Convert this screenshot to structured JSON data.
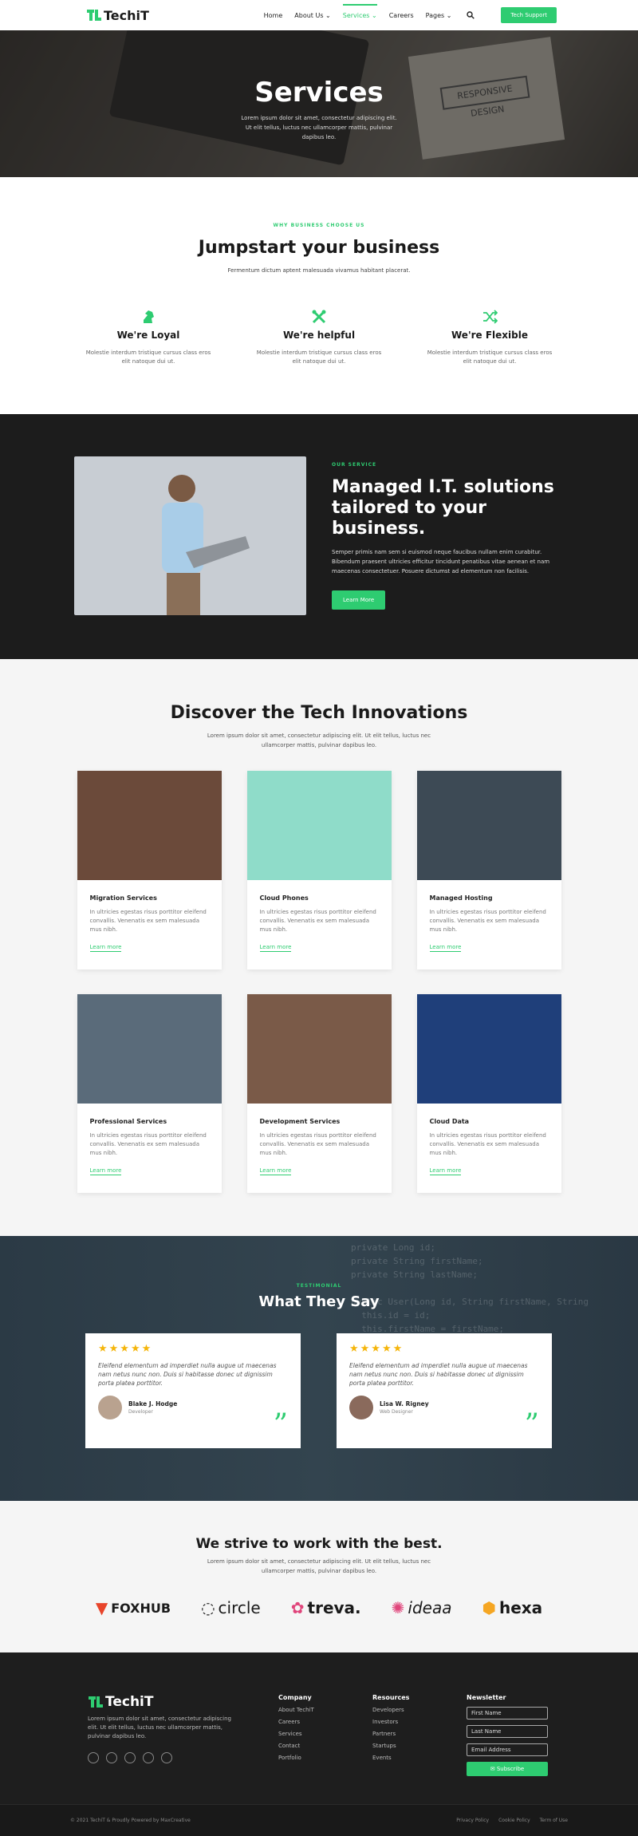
{
  "header": {
    "logo": "TechiT",
    "nav": [
      "Home",
      "About Us",
      "Services",
      "Careers",
      "Pages"
    ],
    "cta": "Tech Support"
  },
  "hero": {
    "title": "Services",
    "text": "Lorem ipsum dolor sit amet, consectetur adipiscing elit. Ut elit tellus, luctus nec ullamcorper mattis, pulvinar dapibus leo.",
    "notebook_text": "RESPONSIVE DESIGN"
  },
  "why": {
    "eyebrow": "WHY BUSINESS CHOOSE US",
    "title": "Jumpstart your business",
    "subtitle": "Fermentum dictum aptent malesuada vivamus habitant placerat.",
    "features": [
      {
        "icon": "horse-icon",
        "title": "We're Loyal",
        "text": "Molestie interdum tristique cursus class eros elit natoque dui ut."
      },
      {
        "icon": "tools-icon",
        "title": "We're helpful",
        "text": "Molestie interdum tristique cursus class eros elit natoque dui ut."
      },
      {
        "icon": "shuffle-icon",
        "title": "We're Flexible",
        "text": "Molestie interdum tristique cursus class eros elit natoque dui ut."
      }
    ]
  },
  "service": {
    "eyebrow": "OUR SERVICE",
    "title": "Managed I.T. solutions tailored to your business.",
    "text": "Semper primis nam sem si euismod neque faucibus nullam enim curabitur. Bibendum praesent ultricies efficitur tincidunt penatibus vitae aenean et nam maecenas consectetuer. Posuere dictumst ad elementum non facilisis.",
    "button": "Learn More"
  },
  "innovations": {
    "title": "Discover the Tech Innovations",
    "subtitle": "Lorem ipsum dolor sit amet, consectetur adipiscing elit. Ut elit tellus, luctus nec ullamcorper mattis, pulvinar dapibus leo.",
    "cards": [
      {
        "title": "Migration Services",
        "text": "In ultricies egestas risus porttitor eleifend convallis. Venenatis ex sem malesuada mus nibh.",
        "link": "Learn more",
        "bg": "#6b4a3a"
      },
      {
        "title": "Cloud Phones",
        "text": "In ultricies egestas risus porttitor eleifend convallis. Venenatis ex sem malesuada mus nibh.",
        "link": "Learn more",
        "bg": "#8fdcc9"
      },
      {
        "title": "Managed Hosting",
        "text": "In ultricies egestas risus porttitor eleifend convallis. Venenatis ex sem malesuada mus nibh.",
        "link": "Learn more",
        "bg": "#3d4a55"
      },
      {
        "title": "Professional Services",
        "text": "In ultricies egestas risus porttitor eleifend convallis. Venenatis ex sem malesuada mus nibh.",
        "link": "Learn more",
        "bg": "#5a6b7a"
      },
      {
        "title": "Development Services",
        "text": "In ultricies egestas risus porttitor eleifend convallis. Venenatis ex sem malesuada mus nibh.",
        "link": "Learn more",
        "bg": "#7a5a48"
      },
      {
        "title": "Cloud Data",
        "text": "In ultricies egestas risus porttitor eleifend convallis. Venenatis ex sem malesuada mus nibh.",
        "link": "Learn more",
        "bg": "#1f3f7a"
      }
    ]
  },
  "testimonials": {
    "eyebrow": "TESTIMONIAL",
    "title": "What They Say",
    "code_bg": "private Long id;\nprivate String firstName;\nprivate String lastName;\n\npublic User(Long id, String firstName, String\n  this.id = id;\n  this.firstName = firstName;\n  this.lastName = lastName;",
    "items": [
      {
        "stars": "★★★★★",
        "quote": "Eleifend elementum ad imperdiet nulla augue ut maecenas nam netus nunc non. Duis si habitasse donec ut dignissim porta platea porttitor.",
        "name": "Blake J. Hodge",
        "role": "Developer"
      },
      {
        "stars": "★★★★★",
        "quote": "Eleifend elementum ad imperdiet nulla augue ut maecenas nam netus nunc non. Duis si habitasse donec ut dignissim porta platea porttitor.",
        "name": "Lisa W. Rigney",
        "role": "Web Designer"
      }
    ]
  },
  "partners": {
    "title": "We strive to work with the best.",
    "subtitle": "Lorem ipsum dolor sit amet, consectetur adipiscing elit. Ut elit tellus, luctus nec ullamcorper mattis, pulvinar dapibus leo.",
    "logos": [
      "FOXHUB",
      "circle",
      "treva.",
      "ideaa",
      "hexa"
    ]
  },
  "footer": {
    "logo": "TechiT",
    "about": "Lorem ipsum dolor sit amet, consectetur adipiscing elit. Ut elit tellus, luctus nec ullamcorper mattis, pulvinar dapibus leo.",
    "company": {
      "title": "Company",
      "links": [
        "About TechiT",
        "Careers",
        "Services",
        "Contact",
        "Portfolio"
      ]
    },
    "resources": {
      "title": "Resources",
      "links": [
        "Developers",
        "Investors",
        "Partners",
        "Startups",
        "Events"
      ]
    },
    "newsletter": {
      "title": "Newsletter",
      "first": "First Name",
      "last": "Last Name",
      "email": "Email Address",
      "button": "Subscribe"
    },
    "copyright": "© 2021 TechiT & Proudly Powered by MaxCreative",
    "legal": [
      "Privacy Policy",
      "Cookie Policy",
      "Term of Use"
    ]
  },
  "colors": {
    "accent": "#2ecc71",
    "dark": "#1c1c1c"
  }
}
